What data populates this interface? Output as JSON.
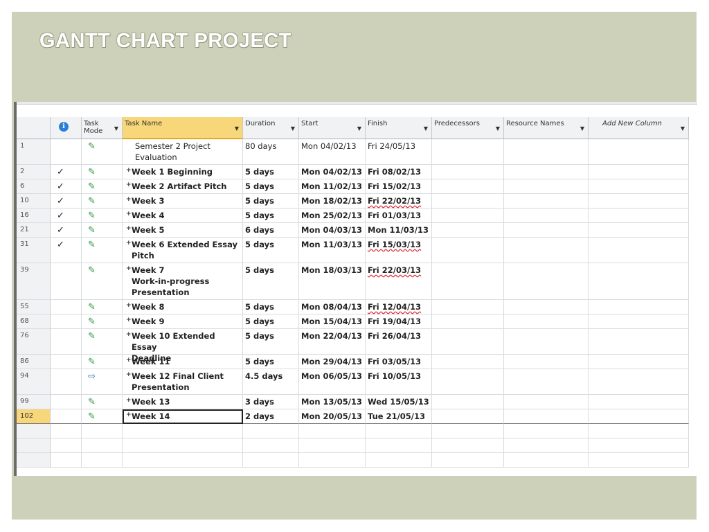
{
  "slide": {
    "title": "GANTT CHART PROJECT"
  },
  "columns": {
    "info": "i",
    "mode": "Task Mode",
    "name": "Task Name",
    "duration": "Duration",
    "start": "Start",
    "finish": "Finish",
    "predecessors": "Predecessors",
    "resources": "Resource Names",
    "add": "Add New Column"
  },
  "colors": {
    "background": "#cdd1b9",
    "selected_header": "#f7d77a",
    "pin": "#2f9a3e"
  },
  "rows": [
    {
      "id": "1",
      "check": "",
      "mode": "manual-pin-icon",
      "expand": "",
      "name_lines": [
        "Semester 2 Project",
        "Evaluation"
      ],
      "bold": false,
      "duration": "80 days",
      "start": "Mon 04/02/13",
      "finish": "Fri 24/05/13",
      "finish_flag": false
    },
    {
      "id": "2",
      "check": "✓",
      "mode": "manual-pin-icon",
      "expand": "+",
      "name_lines": [
        "Week 1 Beginning"
      ],
      "bold": true,
      "duration": "5 days",
      "start": "Mon 04/02/13",
      "finish": "Fri 08/02/13",
      "finish_flag": false
    },
    {
      "id": "6",
      "check": "✓",
      "mode": "manual-pin-icon",
      "expand": "+",
      "name_lines": [
        "Week 2 Artifact Pitch"
      ],
      "bold": true,
      "duration": "5 days",
      "start": "Mon 11/02/13",
      "finish": "Fri 15/02/13",
      "finish_flag": false
    },
    {
      "id": "10",
      "check": "✓",
      "mode": "manual-pin-icon",
      "expand": "+",
      "name_lines": [
        "Week 3"
      ],
      "bold": true,
      "duration": "5 days",
      "start": "Mon 18/02/13",
      "finish": "Fri 22/02/13",
      "finish_flag": true
    },
    {
      "id": "16",
      "check": "✓",
      "mode": "manual-pin-icon",
      "expand": "+",
      "name_lines": [
        "Week 4"
      ],
      "bold": true,
      "duration": "5 days",
      "start": "Mon 25/02/13",
      "finish": "Fri 01/03/13",
      "finish_flag": false
    },
    {
      "id": "21",
      "check": "✓",
      "mode": "manual-pin-icon",
      "expand": "+",
      "name_lines": [
        "Week 5"
      ],
      "bold": true,
      "duration": "6 days",
      "start": "Mon 04/03/13",
      "finish": "Mon 11/03/13",
      "finish_flag": false
    },
    {
      "id": "31",
      "check": "✓",
      "mode": "manual-pin-icon",
      "expand": "+",
      "name_lines": [
        "Week 6 Extended Essay",
        "Pitch"
      ],
      "bold": true,
      "duration": "5 days",
      "start": "Mon 11/03/13",
      "finish": "Fri 15/03/13",
      "finish_flag": true
    },
    {
      "id": "39",
      "check": "",
      "mode": "manual-pin-icon",
      "expand": "+",
      "name_lines": [
        "Week 7",
        "Work-in-progress",
        "Presentation"
      ],
      "bold": true,
      "duration": "5 days",
      "start": "Mon 18/03/13",
      "finish": "Fri 22/03/13",
      "finish_flag": true
    },
    {
      "id": "55",
      "check": "",
      "mode": "manual-pin-icon",
      "expand": "+",
      "name_lines": [
        "Week 8"
      ],
      "bold": true,
      "duration": "5 days",
      "start": "Mon 08/04/13",
      "finish": "Fri 12/04/13",
      "finish_flag": true
    },
    {
      "id": "68",
      "check": "",
      "mode": "manual-pin-icon",
      "expand": "+",
      "name_lines": [
        "Week 9"
      ],
      "bold": true,
      "duration": "5 days",
      "start": "Mon 15/04/13",
      "finish": "Fri 19/04/13",
      "finish_flag": false
    },
    {
      "id": "76",
      "check": "",
      "mode": "manual-pin-icon",
      "expand": "+",
      "name_lines": [
        "Week 10 Extended Essay",
        "Deadline"
      ],
      "bold": true,
      "duration": "5 days",
      "start": "Mon 22/04/13",
      "finish": "Fri 26/04/13",
      "finish_flag": false
    },
    {
      "id": "86",
      "check": "",
      "mode": "manual-pin-icon",
      "expand": "+",
      "name_lines": [
        "Week 11"
      ],
      "bold": true,
      "duration": "5 days",
      "start": "Mon 29/04/13",
      "finish": "Fri 03/05/13",
      "finish_flag": false
    },
    {
      "id": "94",
      "check": "",
      "mode": "auto-schedule-icon",
      "expand": "+",
      "name_lines": [
        "Week 12 Final Client",
        "Presentation"
      ],
      "bold": true,
      "duration": "4.5 days",
      "start": "Mon 06/05/13",
      "finish": "Fri 10/05/13",
      "finish_flag": false
    },
    {
      "id": "99",
      "check": "",
      "mode": "manual-pin-icon",
      "expand": "+",
      "name_lines": [
        "Week 13"
      ],
      "bold": true,
      "duration": "3 days",
      "start": "Mon 13/05/13",
      "finish": "Wed 15/05/13",
      "finish_flag": false
    },
    {
      "id": "102",
      "check": "",
      "mode": "manual-pin-icon",
      "expand": "+",
      "name_lines": [
        "Week 14"
      ],
      "bold": true,
      "duration": "2 days",
      "start": "Mon 20/05/13",
      "finish": "Tue 21/05/13",
      "finish_flag": false,
      "selected": true
    }
  ]
}
